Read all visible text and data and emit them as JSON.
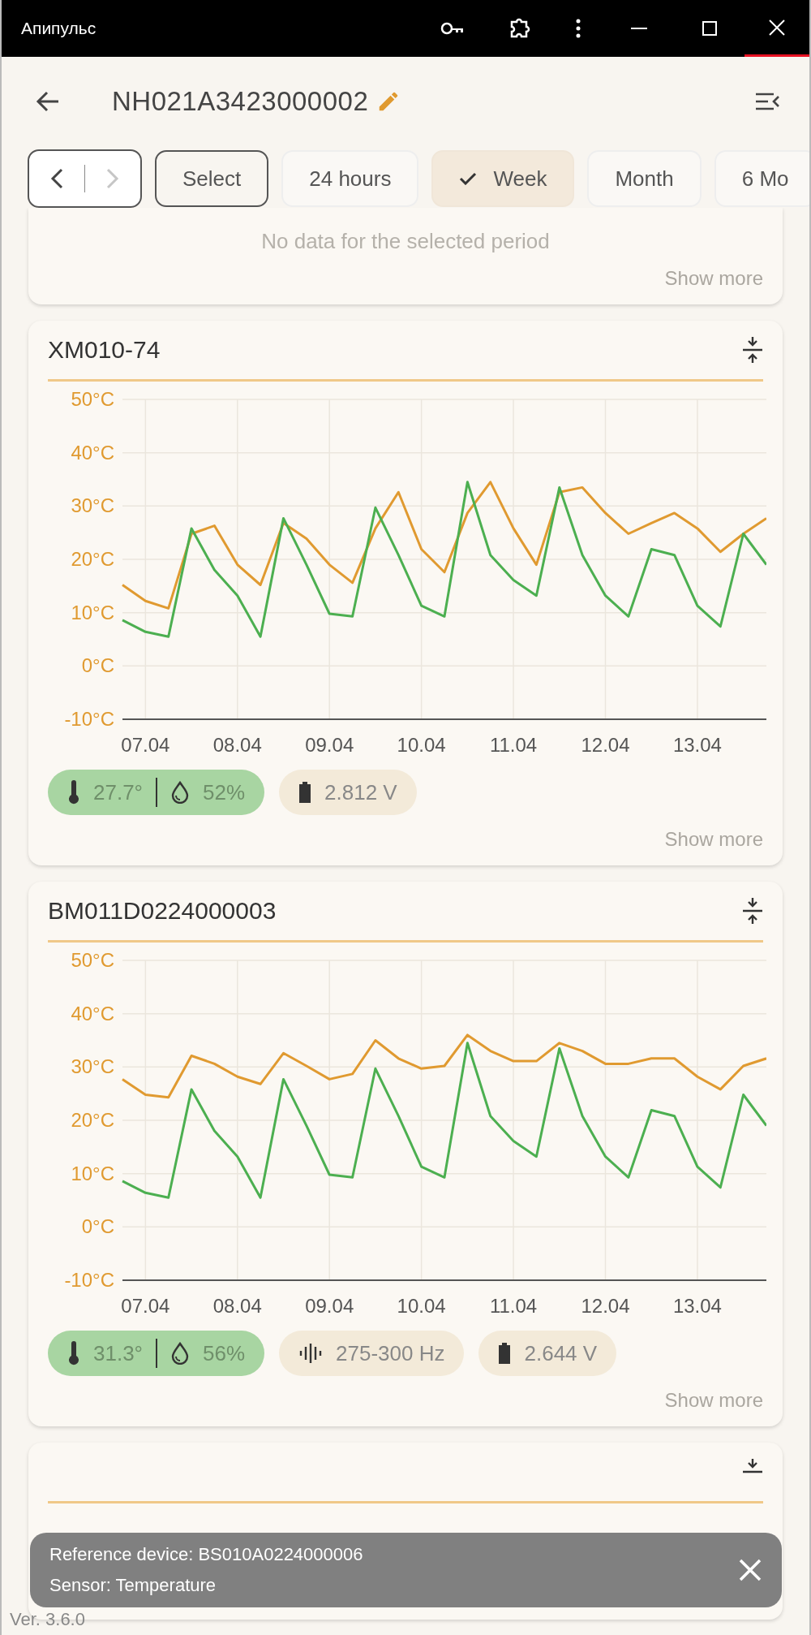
{
  "window": {
    "title": "Апипульс"
  },
  "header": {
    "title": "NH021A3423000002"
  },
  "nav": {
    "prev_disabled": false,
    "next_disabled": true
  },
  "periods": [
    {
      "label": "Select",
      "kind": "custom",
      "selected": false
    },
    {
      "label": "24 hours",
      "kind": "preset",
      "selected": false
    },
    {
      "label": "Week",
      "kind": "preset",
      "selected": true
    },
    {
      "label": "Month",
      "kind": "preset",
      "selected": false
    },
    {
      "label": "6 Mo",
      "kind": "preset",
      "selected": false
    }
  ],
  "cards": [
    {
      "kind": "empty",
      "message": "No data for the selected period",
      "show_more": "Show more"
    },
    {
      "kind": "chart",
      "title": "XM010-74",
      "chart_data": {
        "type": "line",
        "grid": true,
        "categories": [
          null,
          "07.04",
          null,
          null,
          null,
          "08.04",
          null,
          null,
          null,
          "09.04",
          null,
          null,
          null,
          "10.04",
          null,
          null,
          null,
          "11.04",
          null,
          null,
          null,
          "12.04",
          null,
          null,
          null,
          "13.04",
          null,
          null,
          null
        ],
        "ylim": [
          -10,
          50
        ],
        "yticks": [
          {
            "value": 50,
            "label": "50°C"
          },
          {
            "value": 40,
            "label": "40°C"
          },
          {
            "value": 30,
            "label": "30°C"
          },
          {
            "value": 20,
            "label": "20°C"
          },
          {
            "value": 10,
            "label": "10°C"
          },
          {
            "value": 0,
            "label": "0°C"
          },
          {
            "value": -10,
            "label": "-10°C"
          }
        ],
        "series": [
          {
            "color": "#e09a30",
            "values": [
              15.2,
              12.2,
              10.8,
              24.8,
              26.3,
              19,
              15.2,
              26.8,
              23.9,
              19,
              15.6,
              25.8,
              32.6,
              21.9,
              17.6,
              28.7,
              34.5,
              25.8,
              19,
              32.6,
              33.5,
              28.7,
              24.8,
              26.8,
              28.7,
              25.8,
              21.4,
              24.8,
              27.7
            ]
          },
          {
            "color": "#4caf50",
            "values": [
              8.6,
              6.4,
              5.5,
              25.8,
              18,
              13.2,
              5.5,
              27.7,
              19,
              9.8,
              9.3,
              29.7,
              20.8,
              11.3,
              9.3,
              34.5,
              20.8,
              16.1,
              13.2,
              33.5,
              20.8,
              13.2,
              9.3,
              21.9,
              20.8,
              11.3,
              7.4,
              24.8,
              19
            ]
          }
        ]
      },
      "chips": [
        {
          "kind": "climate",
          "temperature": "27.7°",
          "humidity": "52%"
        },
        {
          "kind": "battery",
          "value": "2.812 V"
        }
      ],
      "show_more": "Show more"
    },
    {
      "kind": "chart",
      "title": "BM011D0224000003",
      "chart_data": {
        "type": "line",
        "grid": true,
        "categories": [
          null,
          "07.04",
          null,
          null,
          null,
          "08.04",
          null,
          null,
          null,
          "09.04",
          null,
          null,
          null,
          "10.04",
          null,
          null,
          null,
          "11.04",
          null,
          null,
          null,
          "12.04",
          null,
          null,
          null,
          "13.04",
          null,
          null,
          null
        ],
        "ylim": [
          -10,
          50
        ],
        "yticks": [
          {
            "value": 50,
            "label": "50°C"
          },
          {
            "value": 40,
            "label": "40°C"
          },
          {
            "value": 30,
            "label": "30°C"
          },
          {
            "value": 20,
            "label": "20°C"
          },
          {
            "value": 10,
            "label": "10°C"
          },
          {
            "value": 0,
            "label": "0°C"
          },
          {
            "value": -10,
            "label": "-10°C"
          }
        ],
        "series": [
          {
            "color": "#e09a30",
            "values": [
              27.7,
              24.8,
              24.3,
              32.1,
              30.6,
              28.2,
              26.8,
              32.6,
              30.2,
              27.7,
              28.7,
              35,
              31.6,
              29.7,
              30.2,
              36,
              33,
              31.1,
              31.1,
              34.5,
              33,
              30.6,
              30.6,
              31.6,
              31.6,
              28.2,
              25.8,
              30.2,
              31.6
            ]
          },
          {
            "color": "#4caf50",
            "values": [
              8.6,
              6.4,
              5.5,
              25.8,
              18,
              13.2,
              5.5,
              27.7,
              19,
              9.8,
              9.3,
              29.7,
              20.8,
              11.3,
              9.3,
              34.5,
              20.8,
              16.1,
              13.2,
              33.5,
              20.8,
              13.2,
              9.3,
              21.9,
              20.8,
              11.3,
              7.4,
              24.8,
              19
            ]
          }
        ]
      },
      "chips": [
        {
          "kind": "climate",
          "temperature": "31.3°",
          "humidity": "56%"
        },
        {
          "kind": "vibration",
          "value": "275-300 Hz"
        },
        {
          "kind": "battery",
          "value": "2.644 V"
        }
      ],
      "show_more": "Show more"
    },
    {
      "kind": "clipped"
    }
  ],
  "toast": {
    "lines": [
      "Reference device: BS010A0224000006",
      "Sensor: Temperature"
    ]
  },
  "version": "Ver. 3.6.0"
}
